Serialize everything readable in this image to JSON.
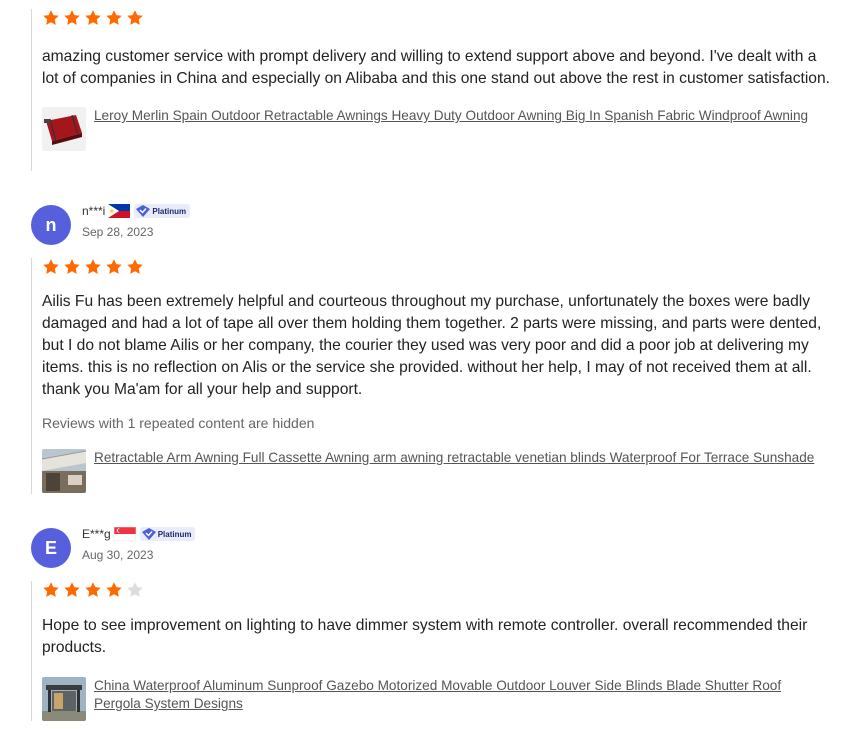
{
  "colors": {
    "star_filled": "#ff6a00",
    "star_empty": "#dddddd",
    "avatar_bg": "#5660dc",
    "link": "#555555"
  },
  "reviews": [
    {
      "rating": 5,
      "text": "amazing customer service with prompt delivery and willing to extend support above and beyond. I've dealt with a lot of companies in China and especially on Alibaba and this one stand out above the rest in customer satisfaction.",
      "product": {
        "icon": "red-awning-thumbnail",
        "title": "Leroy Merlin Spain Outdoor Retractable Awnings Heavy Duty Outdoor Awning Big In Spanish Fabric Windproof Awning"
      }
    },
    {
      "reviewer": {
        "initial": "n",
        "name": "n***i",
        "flag": "philippines-flag",
        "badge": "Platinum",
        "date": "Sep 28, 2023"
      },
      "rating": 5,
      "text": "Ailis Fu has been extremely helpful and courteous throughout my purchase, unfortunately the boxes were badly damaged and had a lot of tape all over them holding them together. 2 parts were missing, and parts were dented, but I do not blame Ailis or her company, the courier they used was very poor and did a poor job at delivering my items. this is no reflection on Alis or the service she provided. without her help, I may of not received them at all. thank you Ma'am for all your help and support.",
      "hidden_note": "Reviews with 1 repeated content are hidden",
      "product": {
        "icon": "cassette-awning-thumbnail",
        "title": "Retractable Arm Awning Full Cassette Awning arm awning retractable venetian blinds Waterproof For Terrace Sunshade"
      }
    },
    {
      "reviewer": {
        "initial": "E",
        "name": "E***g",
        "flag": "singapore-flag",
        "badge": "Platinum",
        "date": "Aug 30, 2023"
      },
      "rating": 4,
      "text": "Hope to see improvement on lighting to have dimmer system with remote controller. overall recommended their products.",
      "product": {
        "icon": "pergola-thumbnail",
        "title": "China Waterproof Aluminum Sunproof Gazebo Motorized Movable Outdoor Louver Side Blinds Blade Shutter Roof Pergola System Designs"
      }
    }
  ]
}
